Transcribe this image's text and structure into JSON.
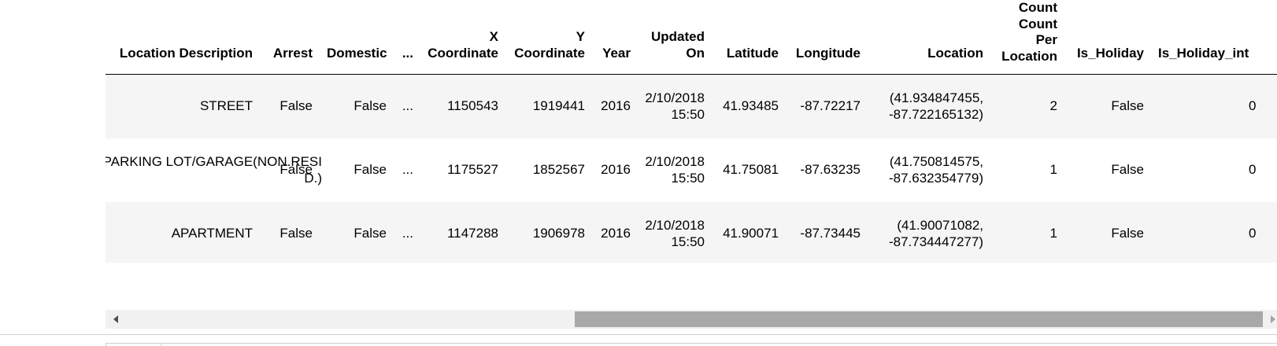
{
  "table": {
    "columns": [
      "Location Description",
      "Arrest",
      "Domestic",
      "...",
      "X Coordinate",
      "Y Coordinate",
      "Year",
      "Updated On",
      "Latitude",
      "Longitude",
      "Location",
      "Count Count Per Location",
      "Is_Holiday",
      "Is_Holiday_int"
    ],
    "header_top_partial": "Count",
    "rows": [
      [
        "STREET",
        "False",
        "False",
        "...",
        "1150543",
        "1919441",
        "2016",
        "2/10/2018 15:50",
        "41.93485",
        "-87.72217",
        "(41.934847455, -87.722165132)",
        "2",
        "False",
        "0"
      ],
      [
        "PARKING LOT/GARAGE(NON.RESID.)",
        "False",
        "False",
        "...",
        "1175527",
        "1852567",
        "2016",
        "2/10/2018 15:50",
        "41.75081",
        "-87.63235",
        "(41.750814575, -87.632354779)",
        "1",
        "False",
        "0"
      ],
      [
        "APARTMENT",
        "False",
        "False",
        "...",
        "1147288",
        "1906978",
        "2016",
        "2/10/2018 15:50",
        "41.90071",
        "-87.73445",
        "(41.90071082, -87.734447277)",
        "1",
        "False",
        "0"
      ]
    ]
  },
  "scrollbar": {
    "thumb_position": 0.5,
    "thumb_size": 0.59
  }
}
